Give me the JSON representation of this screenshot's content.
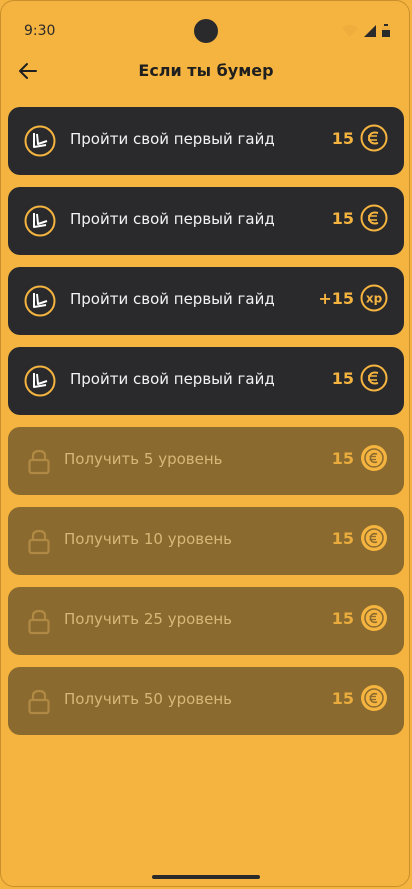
{
  "status": {
    "time": "9:30"
  },
  "header": {
    "title": "Если ты бумер"
  },
  "achievements": [
    {
      "label": "Пройти свой первый гайд",
      "amount": "15",
      "currency": "coin-icon",
      "state": "done"
    },
    {
      "label": "Пройти свой первый гайд",
      "amount": "15",
      "currency": "coin-icon",
      "state": "done"
    },
    {
      "label": "Пройти свой первый гайд",
      "amount": "+15",
      "currency": "xp-icon",
      "currency_text": "xp",
      "state": "done"
    },
    {
      "label": "Пройти свой первый гайд",
      "amount": "15",
      "currency": "coin-icon",
      "state": "done"
    },
    {
      "label": "Получить 5 уровень",
      "amount": "15",
      "currency": "coin-icon",
      "state": "locked"
    },
    {
      "label": "Получить 10 уровень",
      "amount": "15",
      "currency": "coin-icon",
      "state": "locked"
    },
    {
      "label": "Получить 25 уровень",
      "amount": "15",
      "currency": "coin-icon",
      "state": "locked"
    },
    {
      "label": "Получить 50 уровень",
      "amount": "15",
      "currency": "coin-icon",
      "state": "locked"
    }
  ],
  "colors": {
    "background": "#f5b43f",
    "card_done": "#2a2a2d",
    "card_locked": "#8a6a2f",
    "accent": "#f5b43f"
  }
}
